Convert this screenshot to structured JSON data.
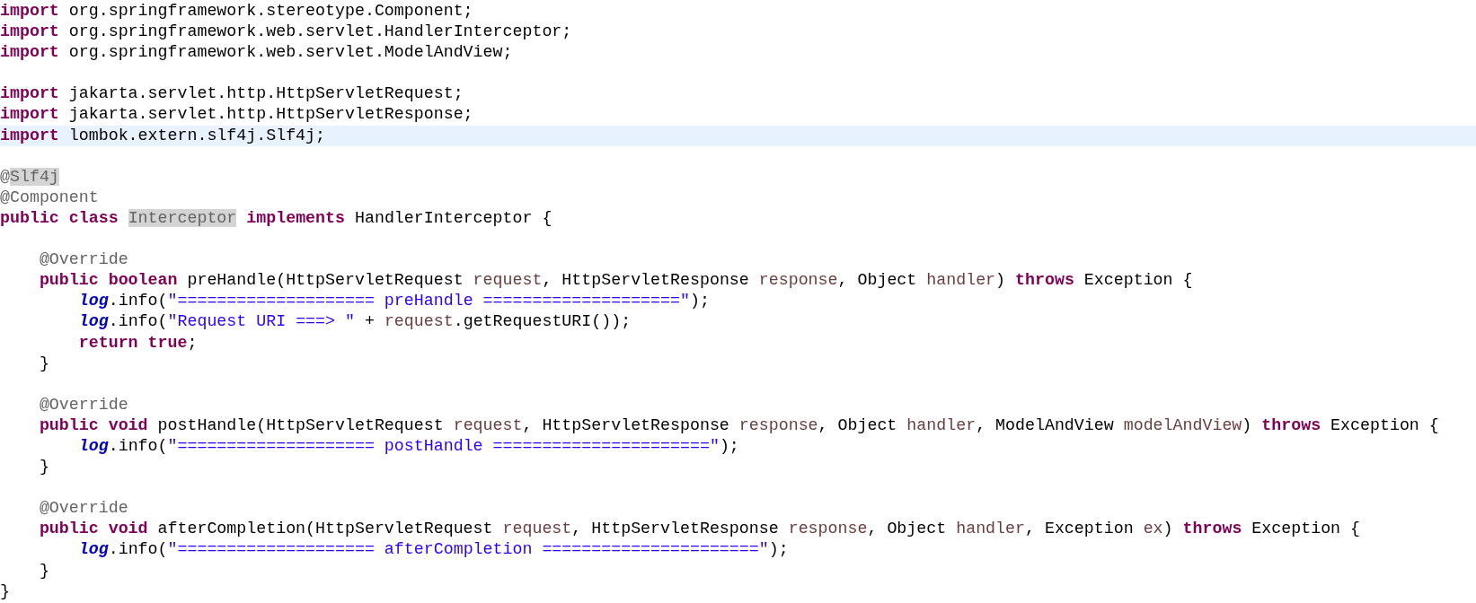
{
  "editor": {
    "lines": [
      {
        "highlighted": false,
        "tokens": [
          {
            "text": "import",
            "kind": "keyword"
          },
          {
            "text": " org.springframework.stereotype.Component;",
            "kind": "plain"
          }
        ]
      },
      {
        "highlighted": false,
        "tokens": [
          {
            "text": "import",
            "kind": "keyword"
          },
          {
            "text": " org.springframework.web.servlet.HandlerInterceptor;",
            "kind": "plain"
          }
        ]
      },
      {
        "highlighted": false,
        "tokens": [
          {
            "text": "import",
            "kind": "keyword"
          },
          {
            "text": " org.springframework.web.servlet.ModelAndView;",
            "kind": "plain"
          }
        ]
      },
      {
        "highlighted": false
      },
      {
        "highlighted": false,
        "tokens": [
          {
            "text": "import",
            "kind": "keyword"
          },
          {
            "text": " jakarta.servlet.http.HttpServletRequest;",
            "kind": "plain"
          }
        ]
      },
      {
        "highlighted": false,
        "tokens": [
          {
            "text": "import",
            "kind": "keyword"
          },
          {
            "text": " jakarta.servlet.http.HttpServletResponse;",
            "kind": "plain"
          }
        ]
      },
      {
        "highlighted": true,
        "tokens": [
          {
            "text": "import",
            "kind": "keyword"
          },
          {
            "text": " lombok.extern.slf4j.Slf4j;",
            "kind": "plain"
          }
        ]
      },
      {
        "highlighted": false
      },
      {
        "highlighted": false,
        "tokens": [
          {
            "text": "@",
            "kind": "annotation"
          },
          {
            "text": "Slf4j",
            "kind": "occurrence"
          }
        ]
      },
      {
        "highlighted": false,
        "tokens": [
          {
            "text": "@Component",
            "kind": "annotation"
          }
        ]
      },
      {
        "highlighted": false,
        "tokens": [
          {
            "text": "public class ",
            "kind": "keyword"
          },
          {
            "text": "Interceptor",
            "kind": "occurrence"
          },
          {
            "text": " implements",
            "kind": "keyword"
          },
          {
            "text": " HandlerInterceptor {",
            "kind": "plain"
          }
        ]
      },
      {
        "highlighted": false
      },
      {
        "highlighted": false,
        "tokens": [
          {
            "text": "    @Override",
            "kind": "annotation"
          }
        ]
      },
      {
        "highlighted": false,
        "tokens": [
          {
            "text": "    public boolean",
            "kind": "keyword"
          },
          {
            "text": " preHandle(HttpServletRequest ",
            "kind": "plain"
          },
          {
            "text": "request",
            "kind": "param"
          },
          {
            "text": ", HttpServletResponse ",
            "kind": "plain"
          },
          {
            "text": "response",
            "kind": "param"
          },
          {
            "text": ", Object ",
            "kind": "plain"
          },
          {
            "text": "handler",
            "kind": "param"
          },
          {
            "text": ") ",
            "kind": "plain"
          },
          {
            "text": "throws",
            "kind": "keyword"
          },
          {
            "text": " Exception {",
            "kind": "plain"
          }
        ]
      },
      {
        "highlighted": false,
        "tokens": [
          {
            "text": "        log",
            "kind": "field"
          },
          {
            "text": ".info(",
            "kind": "plain"
          },
          {
            "text": "\"==================== preHandle ====================\"",
            "kind": "string"
          },
          {
            "text": ");",
            "kind": "plain"
          }
        ]
      },
      {
        "highlighted": false,
        "tokens": [
          {
            "text": "        log",
            "kind": "field"
          },
          {
            "text": ".info(",
            "kind": "plain"
          },
          {
            "text": "\"Request URI ===> \"",
            "kind": "string"
          },
          {
            "text": " + ",
            "kind": "plain"
          },
          {
            "text": "request",
            "kind": "param"
          },
          {
            "text": ".getRequestURI());",
            "kind": "plain"
          }
        ]
      },
      {
        "highlighted": false,
        "tokens": [
          {
            "text": "        return true",
            "kind": "keyword"
          },
          {
            "text": ";",
            "kind": "plain"
          }
        ]
      },
      {
        "highlighted": false,
        "tokens": [
          {
            "text": "    }",
            "kind": "plain"
          }
        ]
      },
      {
        "highlighted": false
      },
      {
        "highlighted": false,
        "tokens": [
          {
            "text": "    @Override",
            "kind": "annotation"
          }
        ]
      },
      {
        "highlighted": false,
        "tokens": [
          {
            "text": "    public void",
            "kind": "keyword"
          },
          {
            "text": " postHandle(HttpServletRequest ",
            "kind": "plain"
          },
          {
            "text": "request",
            "kind": "param"
          },
          {
            "text": ", HttpServletResponse ",
            "kind": "plain"
          },
          {
            "text": "response",
            "kind": "param"
          },
          {
            "text": ", Object ",
            "kind": "plain"
          },
          {
            "text": "handler",
            "kind": "param"
          },
          {
            "text": ", ModelAndView ",
            "kind": "plain"
          },
          {
            "text": "modelAndView",
            "kind": "param"
          },
          {
            "text": ") ",
            "kind": "plain"
          },
          {
            "text": "throws",
            "kind": "keyword"
          },
          {
            "text": " Exception {",
            "kind": "plain"
          }
        ]
      },
      {
        "highlighted": false,
        "tokens": [
          {
            "text": "        log",
            "kind": "field"
          },
          {
            "text": ".info(",
            "kind": "plain"
          },
          {
            "text": "\"==================== postHandle ======================\"",
            "kind": "string"
          },
          {
            "text": ");",
            "kind": "plain"
          }
        ]
      },
      {
        "highlighted": false,
        "tokens": [
          {
            "text": "    }",
            "kind": "plain"
          }
        ]
      },
      {
        "highlighted": false
      },
      {
        "highlighted": false,
        "tokens": [
          {
            "text": "    @Override",
            "kind": "annotation"
          }
        ]
      },
      {
        "highlighted": false,
        "tokens": [
          {
            "text": "    public void",
            "kind": "keyword"
          },
          {
            "text": " afterCompletion(HttpServletRequest ",
            "kind": "plain"
          },
          {
            "text": "request",
            "kind": "param"
          },
          {
            "text": ", HttpServletResponse ",
            "kind": "plain"
          },
          {
            "text": "response",
            "kind": "param"
          },
          {
            "text": ", Object ",
            "kind": "plain"
          },
          {
            "text": "handler",
            "kind": "param"
          },
          {
            "text": ", Exception ",
            "kind": "plain"
          },
          {
            "text": "ex",
            "kind": "param"
          },
          {
            "text": ") ",
            "kind": "plain"
          },
          {
            "text": "throws",
            "kind": "keyword"
          },
          {
            "text": " Exception {",
            "kind": "plain"
          }
        ]
      },
      {
        "highlighted": false,
        "tokens": [
          {
            "text": "        log",
            "kind": "field"
          },
          {
            "text": ".info(",
            "kind": "plain"
          },
          {
            "text": "\"==================== afterCompletion ======================\"",
            "kind": "string"
          },
          {
            "text": ");",
            "kind": "plain"
          }
        ]
      },
      {
        "highlighted": false,
        "tokens": [
          {
            "text": "    }",
            "kind": "plain"
          }
        ]
      },
      {
        "highlighted": false,
        "tokens": [
          {
            "text": "}",
            "kind": "plain"
          }
        ]
      }
    ]
  }
}
